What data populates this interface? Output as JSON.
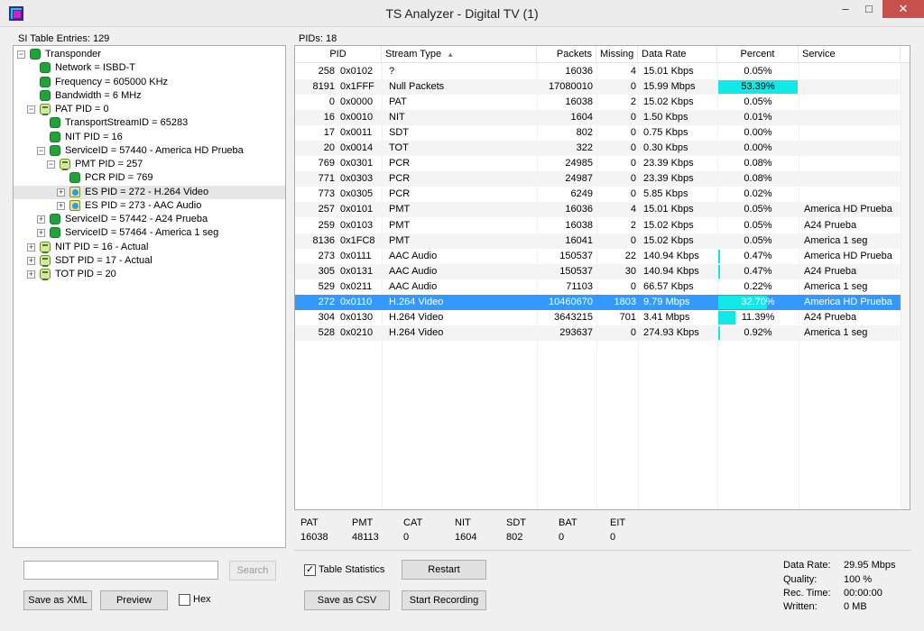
{
  "window": {
    "title": "TS Analyzer - Digital TV (1)",
    "min_glyph": "–",
    "max_glyph": "□",
    "close_glyph": "✕"
  },
  "si_table": {
    "label": "SI Table Entries: 129",
    "tree": [
      {
        "text": "Transponder",
        "icon": "green-node-icon",
        "expander": "−"
      },
      {
        "text": "Network = ISBD-T",
        "icon": "green-node-icon",
        "expander": ""
      },
      {
        "text": "Frequency = 605000 KHz",
        "icon": "green-node-icon",
        "expander": ""
      },
      {
        "text": "Bandwidth = 6 MHz",
        "icon": "green-node-icon",
        "expander": ""
      },
      {
        "text": "PAT PID = 0",
        "icon": "table-icon",
        "expander": "−"
      },
      {
        "text": "TransportStreamID = 65283",
        "icon": "green-node-icon",
        "expander": ""
      },
      {
        "text": "NIT PID = 16",
        "icon": "green-node-icon",
        "expander": ""
      },
      {
        "text": "ServiceID = 57440 - America HD Prueba",
        "icon": "green-node-icon",
        "expander": "−"
      },
      {
        "text": "PMT PID = 257",
        "icon": "table-icon",
        "expander": "−"
      },
      {
        "text": "PCR PID = 769",
        "icon": "green-node-icon",
        "expander": ""
      },
      {
        "text": "ES PID = 272 - H.264 Video",
        "icon": "media-icon",
        "expander": "+"
      },
      {
        "text": "ES PID = 273 - AAC Audio",
        "icon": "media-icon",
        "expander": "+"
      },
      {
        "text": "ServiceID = 57442 - A24 Prueba",
        "icon": "green-node-icon",
        "expander": "+"
      },
      {
        "text": "ServiceID = 57464 - America 1 seg",
        "icon": "green-node-icon",
        "expander": "+"
      },
      {
        "text": "NIT PID = 16 - Actual",
        "icon": "table-icon",
        "expander": "+"
      },
      {
        "text": "SDT PID = 17 - Actual",
        "icon": "table-icon",
        "expander": "+"
      },
      {
        "text": "TOT PID = 20",
        "icon": "table-icon",
        "expander": "+"
      }
    ],
    "search_placeholder": "",
    "search_button": "Search",
    "save_xml_button": "Save as XML",
    "preview_button": "Preview",
    "hex_label": "Hex"
  },
  "pids": {
    "label": "PIDs: 18",
    "columns": [
      "PID",
      "Stream Type",
      "Packets",
      "Missing",
      "Data Rate",
      "Percent",
      "Service"
    ],
    "sort_indicator": "▲",
    "rows": [
      {
        "pid": "258",
        "hex": "0x0102",
        "type": "?",
        "packets": "16036",
        "missing": "4",
        "rate": "15.01 Kbps",
        "percent": "0.05%",
        "bar": 0.0005,
        "service": ""
      },
      {
        "pid": "8191",
        "hex": "0x1FFF",
        "type": "Null Packets",
        "packets": "17080010",
        "missing": "0",
        "rate": "15.99 Mbps",
        "percent": "53.39%",
        "bar": 0.5339,
        "service": ""
      },
      {
        "pid": "0",
        "hex": "0x0000",
        "type": "PAT",
        "packets": "16038",
        "missing": "2",
        "rate": "15.02 Kbps",
        "percent": "0.05%",
        "bar": 0.0005,
        "service": ""
      },
      {
        "pid": "16",
        "hex": "0x0010",
        "type": "NIT",
        "packets": "1604",
        "missing": "0",
        "rate": "1.50 Kbps",
        "percent": "0.01%",
        "bar": 0.0001,
        "service": ""
      },
      {
        "pid": "17",
        "hex": "0x0011",
        "type": "SDT",
        "packets": "802",
        "missing": "0",
        "rate": "0.75 Kbps",
        "percent": "0.00%",
        "bar": 0,
        "service": ""
      },
      {
        "pid": "20",
        "hex": "0x0014",
        "type": "TOT",
        "packets": "322",
        "missing": "0",
        "rate": "0.30 Kbps",
        "percent": "0.00%",
        "bar": 0,
        "service": ""
      },
      {
        "pid": "769",
        "hex": "0x0301",
        "type": "PCR",
        "packets": "24985",
        "missing": "0",
        "rate": "23.39 Kbps",
        "percent": "0.08%",
        "bar": 0.0008,
        "service": ""
      },
      {
        "pid": "771",
        "hex": "0x0303",
        "type": "PCR",
        "packets": "24987",
        "missing": "0",
        "rate": "23.39 Kbps",
        "percent": "0.08%",
        "bar": 0.0008,
        "service": ""
      },
      {
        "pid": "773",
        "hex": "0x0305",
        "type": "PCR",
        "packets": "6249",
        "missing": "0",
        "rate": "5.85 Kbps",
        "percent": "0.02%",
        "bar": 0.0002,
        "service": ""
      },
      {
        "pid": "257",
        "hex": "0x0101",
        "type": "PMT",
        "packets": "16036",
        "missing": "4",
        "rate": "15.01 Kbps",
        "percent": "0.05%",
        "bar": 0.0005,
        "service": "America HD Prueba"
      },
      {
        "pid": "259",
        "hex": "0x0103",
        "type": "PMT",
        "packets": "16038",
        "missing": "2",
        "rate": "15.02 Kbps",
        "percent": "0.05%",
        "bar": 0.0005,
        "service": "A24 Prueba"
      },
      {
        "pid": "8136",
        "hex": "0x1FC8",
        "type": "PMT",
        "packets": "16041",
        "missing": "0",
        "rate": "15.02 Kbps",
        "percent": "0.05%",
        "bar": 0.0005,
        "service": "America 1 seg"
      },
      {
        "pid": "273",
        "hex": "0x0111",
        "type": "AAC Audio",
        "packets": "150537",
        "missing": "22",
        "rate": "140.94 Kbps",
        "percent": "0.47%",
        "bar": 0.0047,
        "service": "America HD Prueba"
      },
      {
        "pid": "305",
        "hex": "0x0131",
        "type": "AAC Audio",
        "packets": "150537",
        "missing": "30",
        "rate": "140.94 Kbps",
        "percent": "0.47%",
        "bar": 0.0047,
        "service": "A24 Prueba"
      },
      {
        "pid": "529",
        "hex": "0x0211",
        "type": "AAC Audio",
        "packets": "71103",
        "missing": "0",
        "rate": "66.57 Kbps",
        "percent": "0.22%",
        "bar": 0.0022,
        "service": "America 1 seg"
      },
      {
        "pid": "272",
        "hex": "0x0110",
        "type": "H.264 Video",
        "packets": "10460670",
        "missing": "1803",
        "rate": "9.79 Mbps",
        "percent": "32.70%",
        "bar": 0.327,
        "service": "America HD Prueba"
      },
      {
        "pid": "304",
        "hex": "0x0130",
        "type": "H.264 Video",
        "packets": "3643215",
        "missing": "701",
        "rate": "3.41 Mbps",
        "percent": "11.39%",
        "bar": 0.1139,
        "service": "A24 Prueba"
      },
      {
        "pid": "528",
        "hex": "0x0210",
        "type": "H.264 Video",
        "packets": "293637",
        "missing": "0",
        "rate": "274.93 Kbps",
        "percent": "0.92%",
        "bar": 0.0092,
        "service": "America 1 seg"
      }
    ],
    "selected_row": 15,
    "bar_color": "#12e8e8",
    "selection_color": "#3399ff"
  },
  "stats": [
    {
      "name": "PAT",
      "value": "16038"
    },
    {
      "name": "PMT",
      "value": "48113"
    },
    {
      "name": "CAT",
      "value": "0"
    },
    {
      "name": "NIT",
      "value": "1604"
    },
    {
      "name": "SDT",
      "value": "802"
    },
    {
      "name": "BAT",
      "value": "0"
    },
    {
      "name": "EIT",
      "value": "0"
    }
  ],
  "controls": {
    "table_statistics_label": "Table Statistics",
    "table_statistics_checked": true,
    "restart_button": "Restart",
    "save_csv_button": "Save as CSV",
    "start_recording_button": "Start Recording"
  },
  "info": {
    "data_rate_label": "Data Rate:",
    "data_rate_value": "29.95 Mbps",
    "quality_label": "Quality:",
    "quality_value": "100 %",
    "rec_time_label": "Rec. Time:",
    "rec_time_value": "00:00:00",
    "written_label": "Written:",
    "written_value": "0 MB"
  }
}
